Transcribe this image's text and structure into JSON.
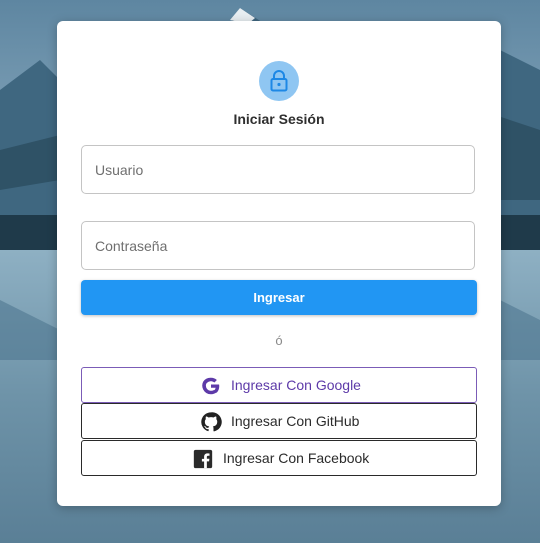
{
  "login": {
    "title": "Iniciar Sesión",
    "lock_icon": "lock-icon",
    "username_placeholder": "Usuario",
    "password_placeholder": "Contraseña",
    "submit_label": "Ingresar",
    "separator": "ó"
  },
  "social": {
    "google_label": "Ingresar Con Google",
    "github_label": "Ingresar Con GitHub",
    "facebook_label": "Ingresar Con Facebook"
  },
  "colors": {
    "primary": "#2196f3",
    "lock_circle": "#8fc6f2",
    "google_accent": "#5d3aa8"
  }
}
